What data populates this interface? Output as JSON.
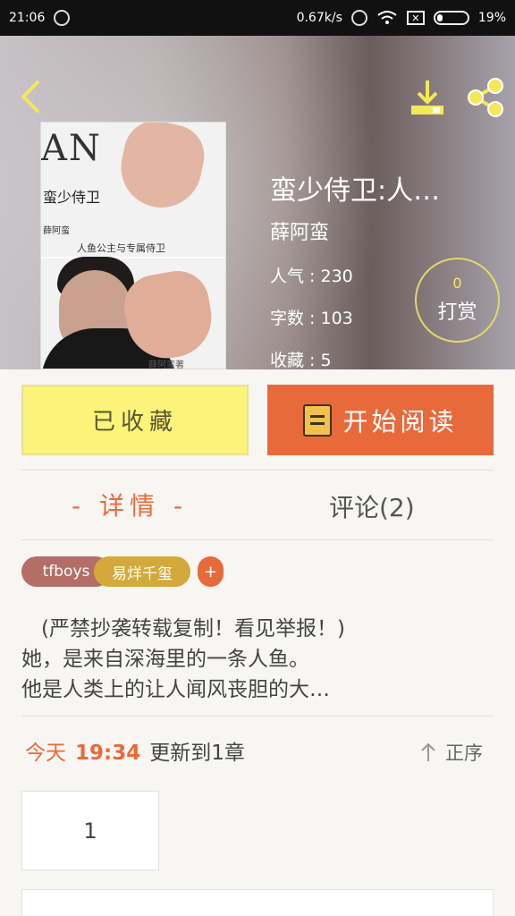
{
  "status_bar": {
    "time": "21:06",
    "speed": "0.67k/s",
    "battery_percent": "19%"
  },
  "book": {
    "title": "蛮少侍卫:人…",
    "author": "薛阿蛮",
    "popularity": "人气 : 230",
    "word_count": "字数 : 103",
    "favorites": "收藏 : 5",
    "cover": {
      "an_text": "AN",
      "title_text": "蛮少侍卫",
      "author_text": "薛阿蛮",
      "subtitle_text": "人鱼公主与专属侍卫",
      "sign_text": "薛阿蛮著"
    }
  },
  "reward": {
    "count": "0",
    "label": "打赏"
  },
  "actions": {
    "favorited": "已收藏",
    "start_reading": "开始阅读"
  },
  "tabs": {
    "details": "- 详情 -",
    "comments": "评论(2)"
  },
  "tags": {
    "tf": "tfboys",
    "yy": "易烊千玺",
    "add": "+"
  },
  "description": {
    "line1": "(严禁抄袭转载复制！看见举报！)",
    "line2": "她，是来自深海里的一条人鱼。",
    "line3": "他是人类上的让人闻风丧胆的大…"
  },
  "update": {
    "today": "今天",
    "time": "19:34",
    "text": "更新到1章"
  },
  "sort": {
    "label": "正序"
  },
  "chapter": {
    "first": "1"
  },
  "colors": {
    "accent": "#e86a3b",
    "fav_button": "#fbf37a",
    "tag_tf": "#b56e67",
    "tag_yy": "#d2a93a"
  }
}
